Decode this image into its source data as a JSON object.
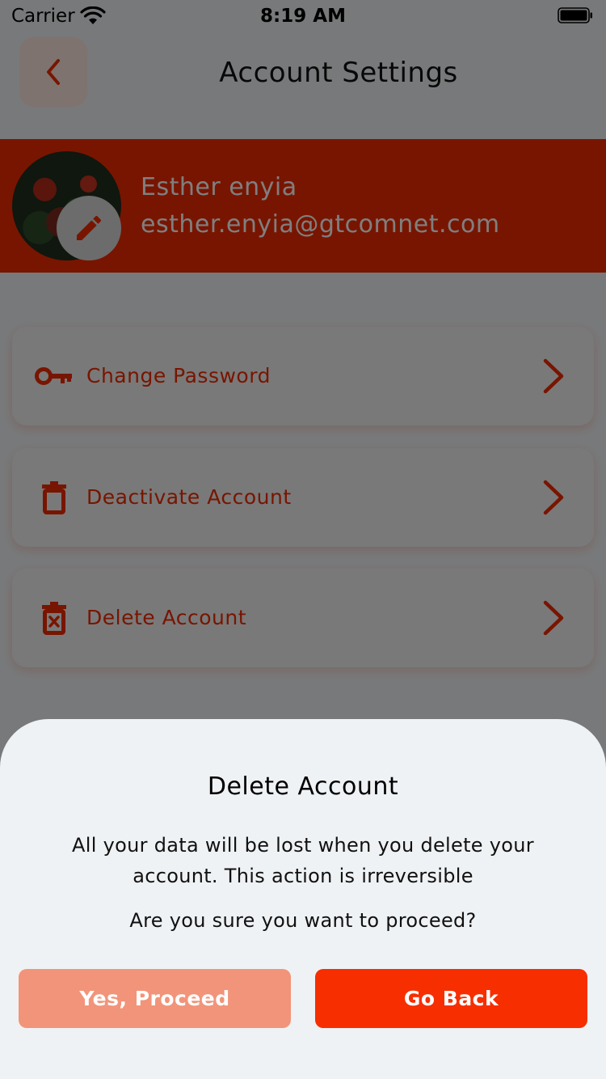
{
  "status_bar": {
    "carrier": "Carrier",
    "time": "8:19 AM",
    "icons": [
      "wifi-icon",
      "battery-icon"
    ]
  },
  "header": {
    "title": "Account Settings",
    "back_icon": "chevron-left-icon"
  },
  "profile": {
    "name": "Esther enyia",
    "email": "esther.enyia@gtcomnet.com",
    "edit_icon": "pencil-icon"
  },
  "settings": [
    {
      "icon": "key-icon",
      "label": "Change Password"
    },
    {
      "icon": "trash-icon",
      "label": "Deactivate Account"
    },
    {
      "icon": "trash-x-icon",
      "label": "Delete Account"
    }
  ],
  "dialog": {
    "title": "Delete Account",
    "message": "All your data will be lost when you delete your account. This action is irreversible",
    "question": "Are you sure you want to proceed?",
    "confirm_label": "Yes, Proceed",
    "cancel_label": "Go Back"
  },
  "colors": {
    "accent": "#f02a00",
    "confirm_button": "#f2947a",
    "cancel_button": "#f72e00",
    "sheet_bg": "#eff2f4"
  }
}
